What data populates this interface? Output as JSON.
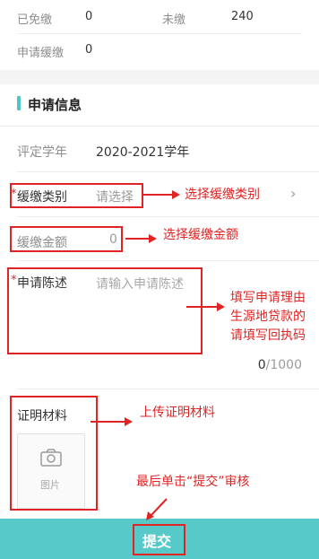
{
  "summary": {
    "exempted_label": "已免缴",
    "exempted_value": "0",
    "unpaid_label": "未缴",
    "unpaid_value": "240",
    "deferred_label": "申请缓缴",
    "deferred_value": "0"
  },
  "section_title": "申请信息",
  "form": {
    "year_label": "评定学年",
    "year_value": "2020-2021学年",
    "required_mark": "*",
    "type_label": "缓缴类别",
    "type_placeholder": "请选择",
    "amount_label": "缓缴金额",
    "amount_value": "0",
    "reason_label": "申请陈述",
    "reason_placeholder": "请输入申请陈述",
    "char_count_current": "0",
    "char_count_max": "/1000",
    "materials_label": "证明材料",
    "upload_label": "图片"
  },
  "submit_label": "提交",
  "annotations": {
    "select_type": "选择缓缴类别",
    "select_amount": "选择缓缴金额",
    "reason_line1": "填写申请理由",
    "reason_line2": "生源地贷款的",
    "reason_line3": "请填写回执码",
    "upload": "上传证明材料",
    "submit": "最后单击“提交”审核"
  },
  "colors": {
    "accent": "#4ec6c6",
    "annotation_red": "#e02424",
    "submit_bg": "#58c9c9"
  }
}
